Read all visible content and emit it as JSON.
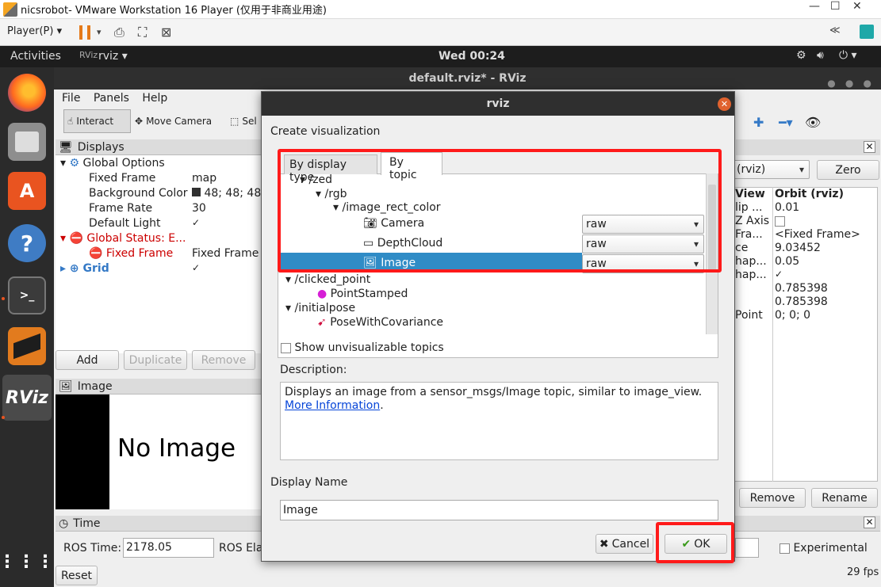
{
  "vmware": {
    "title": "nicsrobot- VMware Workstation 16 Player (仅用于非商业用途)",
    "player_menu": "Player(P)",
    "collapse_label": "≪"
  },
  "ubuntu": {
    "activities": "Activities",
    "app_name": "rviz",
    "clock": "Wed 00:24"
  },
  "rviz": {
    "window_title": "default.rviz* - RViz",
    "menu": [
      "File",
      "Panels",
      "Help"
    ],
    "toolbar": {
      "interact": "Interact",
      "move_camera": "Move Camera",
      "select": "Sel"
    },
    "displays_panel": {
      "title": "Displays",
      "rows": [
        {
          "label": "Global Options",
          "value": ""
        },
        {
          "label": "Fixed Frame",
          "value": "map"
        },
        {
          "label": "Background Color",
          "value": "48; 48; 48"
        },
        {
          "label": "Frame Rate",
          "value": "30"
        },
        {
          "label": "Default Light",
          "value": "✓"
        },
        {
          "label": "Global Status: E...",
          "value": ""
        },
        {
          "label": "Fixed Frame",
          "value": "Fixed Frame"
        },
        {
          "label": "Grid",
          "value": "✓"
        }
      ],
      "buttons": {
        "add": "Add",
        "duplicate": "Duplicate",
        "remove": "Remove"
      }
    },
    "image_panel": {
      "title": "Image",
      "placeholder": "No Image"
    },
    "time_panel": {
      "title": "Time",
      "ros_time_label": "ROS Time:",
      "ros_time_value": "2178.05",
      "ros_elapsed_label": "ROS Ela",
      "experimental": "Experimental",
      "reset": "Reset",
      "fps": "29 fps"
    },
    "views_panel": {
      "type_select": "(rviz)",
      "zero": "Zero",
      "header_left": "View",
      "header_right": "Orbit (rviz)",
      "rows": [
        {
          "label": "lip ...",
          "value": "0.01"
        },
        {
          "label": "Z Axis",
          "value": ""
        },
        {
          "label": "Fra...",
          "value": "<Fixed Frame>"
        },
        {
          "label": "ce",
          "value": "9.03452"
        },
        {
          "label": "hap...",
          "value": "0.05"
        },
        {
          "label": "hap...",
          "value": "✓"
        },
        {
          "label": "",
          "value": "0.785398"
        },
        {
          "label": "",
          "value": "0.785398"
        },
        {
          "label": "Point",
          "value": "0; 0; 0"
        }
      ],
      "remove": "Remove",
      "rename": "Rename"
    }
  },
  "dialog": {
    "title": "rviz",
    "create_label": "Create visualization",
    "tabs": [
      "By display type",
      "By topic"
    ],
    "active_tab": "By topic",
    "tree": [
      {
        "label": "/zed",
        "level": 1,
        "arrow": "▾"
      },
      {
        "label": "/rgb",
        "level": 2,
        "arrow": "▾"
      },
      {
        "label": "/image_rect_color",
        "level": 3,
        "arrow": "▾"
      },
      {
        "label": "Camera",
        "level": 4,
        "select": "raw"
      },
      {
        "label": "DepthCloud",
        "level": 4,
        "select": "raw"
      },
      {
        "label": "Image",
        "level": 4,
        "select": "raw",
        "selected": true
      },
      {
        "label": "/clicked_point",
        "level": 1,
        "arrow": "▾"
      },
      {
        "label": "PointStamped",
        "level": 2
      },
      {
        "label": "/initialpose",
        "level": 1,
        "arrow": "▾"
      },
      {
        "label": "PoseWithCovariance",
        "level": 2
      }
    ],
    "show_unvisualizable": "Show unvisualizable topics",
    "description_label": "Description:",
    "description_text": "Displays an image from a sensor_msgs/Image topic, similar to image_view.",
    "description_link": "More Information",
    "display_name_label": "Display Name",
    "display_name_value": "Image",
    "cancel": "Cancel",
    "ok": "OK"
  },
  "colors": {
    "highlight": "#ff1a1a",
    "selection": "#308cc6",
    "error": "#cc0000"
  }
}
